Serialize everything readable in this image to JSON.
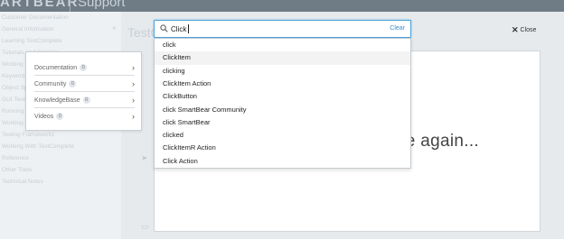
{
  "brand": {
    "logo": "ARTBEAR",
    "subtitle": "Support"
  },
  "background": {
    "nav_items": [
      "Customer Documentation",
      "General Information",
      "Learning TestComplete",
      "Tutorials and Samples",
      "Working With Scripts",
      "Keyword Tests",
      "Object Spy",
      "GUI Tests",
      "Running Tests",
      "Working With Application Objects",
      "Testing Frameworks",
      "Working With TestComplete",
      "Reference",
      "Other Tools",
      "Technical Notes"
    ],
    "page_title": "TestC"
  },
  "content": {
    "message": "ce again..."
  },
  "close": {
    "label": "Close"
  },
  "search": {
    "value": "Click",
    "clear_label": "Clear"
  },
  "suggestions": [
    "click",
    "ClickItem",
    "clicking",
    "ClickItem Action",
    "ClickButton",
    "click SmartBear Community",
    "click SmartBear",
    "clicked",
    "ClickItemR Action",
    "Click Action"
  ],
  "categories": [
    {
      "label": "Documentation",
      "count": "0"
    },
    {
      "label": "Community",
      "count": "0"
    },
    {
      "label": "KnowledgeBase",
      "count": "0"
    },
    {
      "label": "Videos",
      "count": "0"
    }
  ],
  "colors": {
    "accent": "#3a8fd0",
    "focus_border": "#4da3d8",
    "topbar": "#6f7b85"
  }
}
